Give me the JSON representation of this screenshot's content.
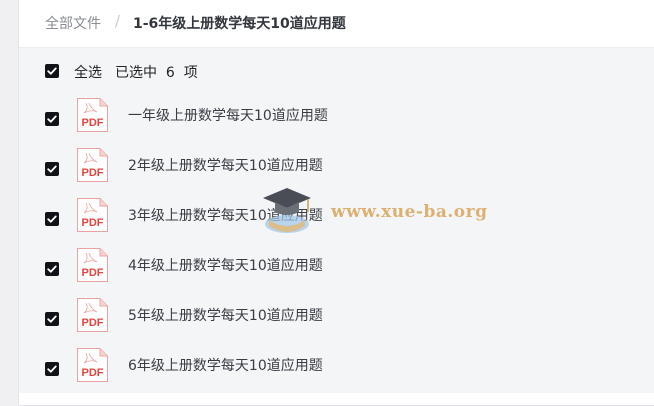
{
  "breadcrumb": {
    "root": "全部文件",
    "separator": "/",
    "current": "1-6年级上册数学每天10道应用题"
  },
  "selection": {
    "select_all_label": "全选",
    "count_text": "已选中  6  项",
    "checked": true
  },
  "files": [
    {
      "name": "一年级上册数学每天10道应用题",
      "type": "PDF",
      "icon": "pdf-file-icon",
      "checked": true
    },
    {
      "name": "2年级上册数学每天10道应用题",
      "type": "PDF",
      "icon": "pdf-file-icon",
      "checked": true
    },
    {
      "name": "3年级上册数学每天10道应用题",
      "type": "PDF",
      "icon": "pdf-file-icon",
      "checked": true
    },
    {
      "name": "4年级上册数学每天10道应用题",
      "type": "PDF",
      "icon": "pdf-file-icon",
      "checked": true
    },
    {
      "name": "5年级上册数学每天10道应用题",
      "type": "PDF",
      "icon": "pdf-file-icon",
      "checked": true
    },
    {
      "name": "6年级上册数学每天10道应用题",
      "type": "PDF",
      "icon": "pdf-file-icon",
      "checked": true
    }
  ],
  "watermark": {
    "text": "www.xue-ba.org"
  },
  "colors": {
    "pdf_red": "#e0453f",
    "checkbox": "#101318",
    "list_bg": "#f4f5f7"
  }
}
